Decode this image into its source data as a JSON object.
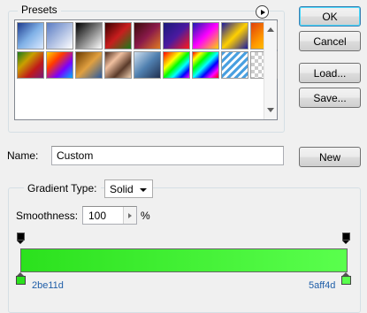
{
  "presets": {
    "label": "Presets",
    "swatches": [
      "linear-gradient(135deg,#1e3c8f,#7fb0e6,#dbe9ff)",
      "linear-gradient(135deg,#5a7cc4 0%,rgba(90,124,196,0) 100%)",
      "linear-gradient(135deg,#000,#fff)",
      "linear-gradient(135deg,#3a0000,#c81e1e,#1a7a1a)",
      "linear-gradient(135deg,#3b0a0a,#8a1a4a,#e07a20)",
      "linear-gradient(135deg,#1a1a7a,#4a1aa0,#ff1a1a)",
      "linear-gradient(135deg,#1a1ab0,#ff00ff,#ffd400)",
      "linear-gradient(135deg,#1a1aa0,#ffd000,#1a1aa0)",
      "linear-gradient(135deg,#e0400a,#ff9a00,#ffe000)",
      "linear-gradient(135deg,#1a7a1a,#c8a000,#c01a1a,#7a1a7a)",
      "linear-gradient(135deg,#ffd400,#ff3a00,#7a00ff,#00b0ff)",
      "linear-gradient(135deg,#6a3a00,#e0a040,#2a5aa0)",
      "linear-gradient(135deg,#4a2a1a,#f0c0a0,#5a3a2a,#f0d0b0)",
      "linear-gradient(135deg,#d0e0f0,#5080b0,#203050)",
      "linear-gradient(135deg,#ff0000,#ff8000,#ffff00,#00ff00,#00ffff,#0000ff,#ff00ff)",
      "linear-gradient(135deg,#ff0000,#ffff00,#00ff00,#00ffff,#0000ff,#ff00ff,#ff0000)",
      "repeating-linear-gradient(135deg,#4aa0e0 0 3px,#fff 3px 6px)",
      "checker"
    ]
  },
  "buttons": {
    "ok": "OK",
    "cancel": "Cancel",
    "load": "Load...",
    "save": "Save...",
    "new": "New"
  },
  "name": {
    "label": "Name:",
    "value": "Custom"
  },
  "gradient": {
    "type_label": "Gradient Type:",
    "type_value": "Solid",
    "smoothness_label": "Smoothness:",
    "smoothness_value": "100",
    "smoothness_unit": "%",
    "stops": [
      {
        "color": "#2be11d",
        "label": "2be11d",
        "location": 0
      },
      {
        "color": "#5aff4d",
        "label": "5aff4d",
        "location": 100
      }
    ]
  },
  "colors": {
    "start": "#2be11d",
    "end": "#5aff4d"
  }
}
